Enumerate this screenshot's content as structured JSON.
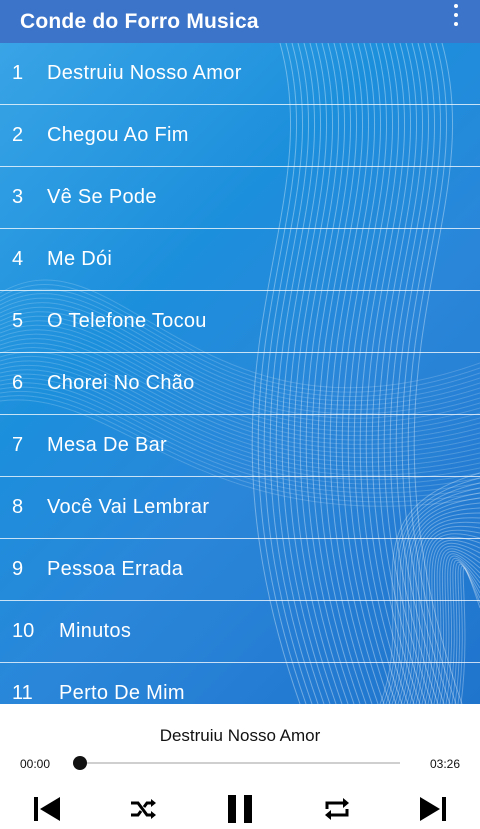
{
  "app": {
    "title": "Conde do Forro Musica"
  },
  "songs": [
    {
      "number": "1",
      "title": "Destruiu Nosso Amor"
    },
    {
      "number": "2",
      "title": "Chegou Ao Fim"
    },
    {
      "number": "3",
      "title": "Vê Se Pode"
    },
    {
      "number": "4",
      "title": "Me Dói"
    },
    {
      "number": "5",
      "title": "O Telefone Tocou"
    },
    {
      "number": "6",
      "title": "Chorei No Chão"
    },
    {
      "number": "7",
      "title": "Mesa De Bar"
    },
    {
      "number": "8",
      "title": "Você Vai Lembrar"
    },
    {
      "number": "9",
      "title": "Pessoa Errada"
    },
    {
      "number": "10",
      "title": "Minutos"
    },
    {
      "number": "11",
      "title": "Perto De Mim"
    }
  ],
  "player": {
    "now_playing": "Destruiu Nosso Amor",
    "elapsed": "00:00",
    "duration": "03:26",
    "progress": 0
  },
  "icons": {
    "menu": "overflow-menu-icon",
    "previous": "skip-previous-icon",
    "shuffle": "shuffle-icon",
    "pause": "pause-icon",
    "repeat": "repeat-icon",
    "next": "skip-next-icon"
  },
  "colors": {
    "appbar": "#3b74c9",
    "list_bg": "#2a8ddb"
  }
}
